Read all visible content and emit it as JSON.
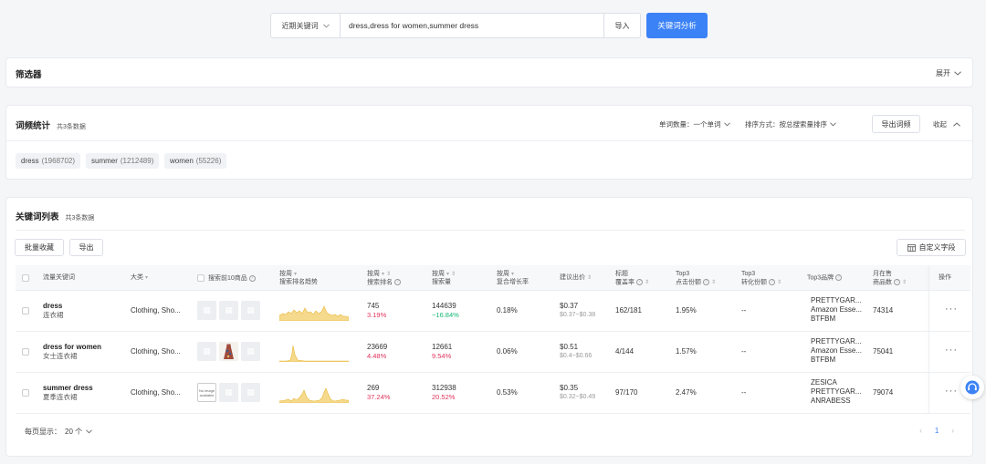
{
  "search": {
    "select_label": "近期关键词",
    "value": "dress,dress for women,summer dress",
    "import_label": "导入",
    "analyze_label": "关键词分析"
  },
  "filter": {
    "title": "筛选器",
    "expand_label": "展开"
  },
  "freq": {
    "title": "词频统计",
    "count_label": "共3条数据",
    "word_count_label": "单词数量：一个单词",
    "sort_label": "排序方式：按总搜索量排序",
    "export_label": "导出词频",
    "collapse_label": "收起",
    "tags": [
      {
        "word": "dress",
        "count": "(1968702)"
      },
      {
        "word": "summer",
        "count": "(1212489)"
      },
      {
        "word": "women",
        "count": "(55226)"
      }
    ]
  },
  "kwlist": {
    "title": "关键词列表",
    "count_label": "共3条数据",
    "batch_fav_label": "批量收藏",
    "export_label": "导出",
    "custom_fields_label": "自定义字段",
    "headers": {
      "keyword": "流量关键词",
      "category": "大类",
      "top10": "搜索前10商品",
      "trend_a": "按周",
      "trend_b": "搜索排名趋势",
      "rank_a": "按周",
      "rank_b": "搜索排名",
      "volume_a": "按周",
      "volume_b": "搜索量",
      "growth_a": "按周",
      "growth_b": "复合增长率",
      "bid": "建议出价",
      "title_a": "标题",
      "title_b": "覆盖率",
      "click_a": "Top3",
      "click_b": "点击份额",
      "conv_a": "Top3",
      "conv_b": "转化份额",
      "brands": "Top3品牌",
      "monthly_a": "月在售",
      "monthly_b": "商品数",
      "ops": "操作"
    },
    "rows": [
      {
        "kw": "dress",
        "kw_cn": "连衣裙",
        "category": "Clothing, Sho...",
        "rank": "745",
        "rank_change": "3.19%",
        "volume": "144639",
        "volume_change": "−16.84%",
        "growth": "0.18%",
        "bid": "$0.37",
        "bid_range": "$0.37~$0.38",
        "coverage": "162/181",
        "click_share": "1.95%",
        "conv_share": "--",
        "brand1": "PRETTYGAR...",
        "brand2": "Amazon Esse...",
        "brand3": "BTFBM",
        "monthly": "74314",
        "ops": "···"
      },
      {
        "kw": "dress for women",
        "kw_cn": "女士连衣裙",
        "category": "Clothing, Sho...",
        "rank": "23669",
        "rank_change": "4.48%",
        "volume": "12661",
        "volume_change": "9.54%",
        "growth": "0.06%",
        "bid": "$0.51",
        "bid_range": "$0.4~$0.66",
        "coverage": "4/144",
        "click_share": "1.57%",
        "conv_share": "--",
        "brand1": "PRETTYGAR...",
        "brand2": "Amazon Esse...",
        "brand3": "BTFBM",
        "monthly": "75041",
        "ops": "···"
      },
      {
        "kw": "summer dress",
        "kw_cn": "夏季连衣裙",
        "category": "Clothing, Sho...",
        "rank": "269",
        "rank_change": "37.24%",
        "volume": "312938",
        "volume_change": "20.52%",
        "growth": "0.53%",
        "bid": "$0.35",
        "bid_range": "$0.32~$0.49",
        "coverage": "97/170",
        "click_share": "2.47%",
        "conv_share": "--",
        "brand1": "ZESICA",
        "brand2": "PRETTYGAR...",
        "brand3": "ANRABESS",
        "monthly": "79074",
        "ops": "···",
        "noimg_text": "No image available"
      }
    ],
    "page_size_label": "每页显示：",
    "page_size_value": "20 个",
    "current_page": "1"
  },
  "colors": {
    "accent": "#3b82f6",
    "spark_fill": "#f5d98c",
    "spark_line": "#e8b83a",
    "up": "#e0335b",
    "down": "#15b776"
  }
}
